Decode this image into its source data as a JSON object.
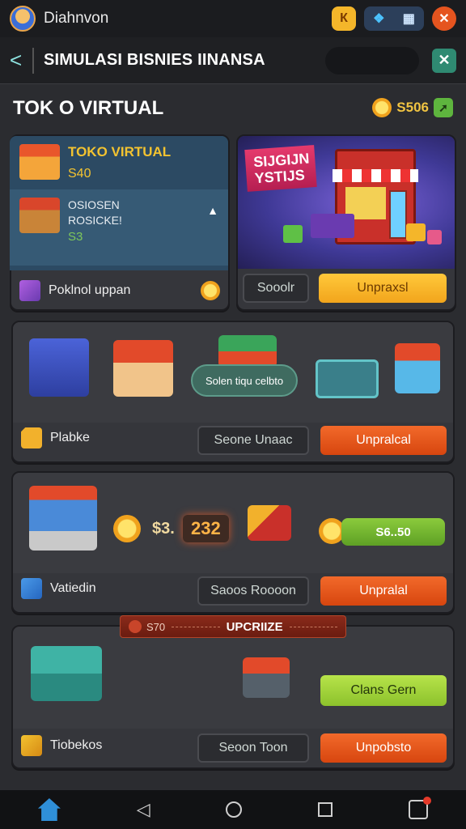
{
  "topbar": {
    "app_name": "Diahnvon",
    "btn_yellow": "К",
    "btn_close": "✕"
  },
  "header": {
    "back": "<",
    "title": "SIMULASI BISNIES IINANSA",
    "close": "✕"
  },
  "page": {
    "title": "TOK O VIRTUAL",
    "coins": "S506",
    "coin_add": "➚"
  },
  "card1": {
    "shop_name": "TOKO VIRTUAL",
    "shop_price": "S40",
    "item_line1": "OSIOSEN",
    "item_line2": "ROSICKE!",
    "item_price": "S3",
    "footer_label": "Poklnol uppan"
  },
  "card2": {
    "banner_text": "SIJGIJN YSTIJS",
    "ghost_btn": "Sooolr",
    "main_btn": "Unpraxsl"
  },
  "row1": {
    "bubble": "Solen tiqu celbto",
    "label": "Plabke",
    "ghost_btn": "Seone  Unaac",
    "main_btn": "Unpralcal"
  },
  "row2": {
    "amount": "232",
    "prefix": "$3.",
    "pill": "S6..50",
    "label": "Vatiedin",
    "ghost_btn": "Saoos Roooon",
    "main_btn": "Unpralal"
  },
  "row3": {
    "ribbon_left": "S70",
    "ribbon": "UPCRIIZE",
    "green_btn": "Clans Gern",
    "label": "Tiobekos",
    "ghost_btn": "Seoon  Toon",
    "main_btn": "Unpobsto"
  },
  "colors": {
    "accent_orange": "#e0501a",
    "accent_gold": "#f4b62a",
    "accent_green": "#8cc22c",
    "bg": "#2b2c30"
  }
}
